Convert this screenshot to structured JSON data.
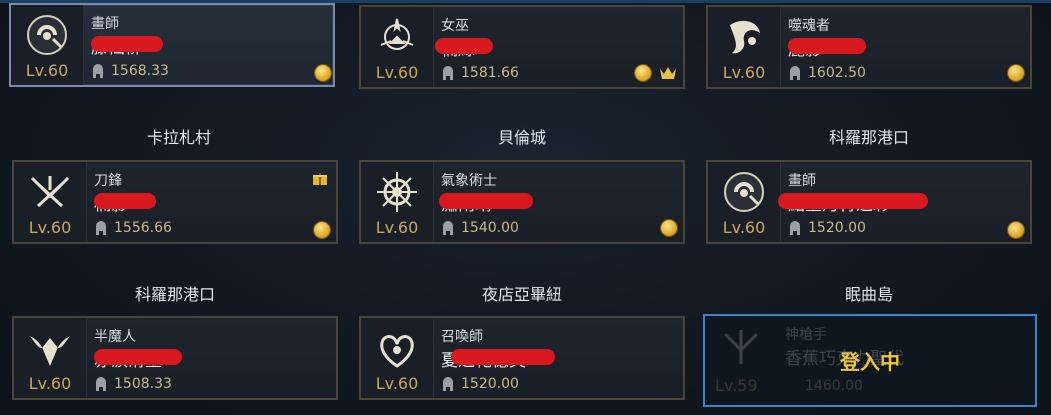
{
  "cards": [
    {
      "cls": "畫師",
      "lv": "Lv.60",
      "gs": "1568.33",
      "name": "藤仙柳"
    },
    {
      "cls": "女巫",
      "lv": "Lv.60",
      "gs": "1581.66",
      "name": "楠絲"
    },
    {
      "cls": "噬魂者",
      "lv": "Lv.60",
      "gs": "1602.50",
      "name": "麓影"
    },
    {
      "cls": "刀鋒",
      "lv": "Lv.60",
      "gs": "1556.66",
      "name": "楠影"
    },
    {
      "cls": "氣象術士",
      "lv": "Lv.60",
      "gs": "1540.00",
      "name": "瀟雨晴"
    },
    {
      "cls": "畫師",
      "lv": "Lv.60",
      "gs": "1520.00",
      "name": "點墨丹青之彩"
    },
    {
      "cls": "半魔人",
      "lv": "Lv.60",
      "gs": "1508.33",
      "name": "赤淚滑墨"
    },
    {
      "cls": "召喚師",
      "lv": "Lv.60",
      "gs": "1520.00",
      "name": "夏之花憶芙"
    }
  ],
  "locations": [
    "卡拉札村",
    "貝倫城",
    "科羅那港口",
    "科羅那港口",
    "夜店亞畢紐",
    "眠曲島"
  ],
  "login": {
    "message": "登入中",
    "cls": "神槍手",
    "name": "香蕉巧克力聖代",
    "lv": "Lv.59",
    "gs": "1460.00"
  },
  "colors": {
    "card_border": "#4a4534",
    "selected_border": "#7c8aa6",
    "login_border": "#3a86c9",
    "level": "#c9a95c",
    "redaction": "#d8191f"
  },
  "icons": {
    "gear_score": "helmet-icon",
    "currency": "gold-coin-icon",
    "leader": "crown-icon",
    "reward": "gift-icon"
  }
}
